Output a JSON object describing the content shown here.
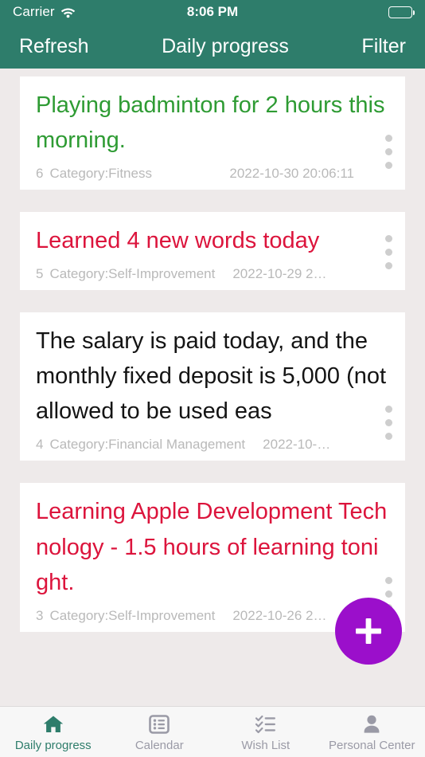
{
  "status_bar": {
    "carrier": "Carrier",
    "wifi_icon": "wifi-icon",
    "time": "8:06 PM",
    "battery_icon": "battery-full-icon"
  },
  "nav_bar": {
    "left_button": "Refresh",
    "title": "Daily progress",
    "right_button": "Filter"
  },
  "colors": {
    "brand_teal": "#2E7D6B",
    "page_background": "#EEEAEA",
    "card_background": "#FFFFFF",
    "accent_green": "#2E9B33",
    "accent_red": "#DC143C",
    "text_black": "#141414",
    "meta_gray": "#B9B9B9",
    "fab_purple": "#9B0FCB",
    "tab_inactive": "#9A9AA6"
  },
  "list": {
    "items": [
      {
        "title": "Playing badminton for 2 hours this morning.",
        "color": "green",
        "id": "6",
        "category": "Category:Fitness",
        "date": "2022-10-30 20:06:11",
        "menu_icon": "more-vertical-icon"
      },
      {
        "title": "Learned 4 new words today",
        "color": "red",
        "id": "5",
        "category": "Category:Self-Improvement",
        "date": "2022-10-29 2…",
        "menu_icon": "more-vertical-icon"
      },
      {
        "title": "The salary is paid today, and the monthly fixed deposit is 5,000 (not allowed to be used eas",
        "color": "black",
        "id": "4",
        "category": "Category:Financial Management",
        "date": "2022-10-…",
        "menu_icon": "more-vertical-icon"
      },
      {
        "title": "Learning Apple Development Technology - 1.5 hours of learning tonight.",
        "color": "red",
        "id": "3",
        "category": "Category:Self-Improvement",
        "date": "2022-10-26 2…",
        "menu_icon": "more-vertical-icon"
      }
    ]
  },
  "fab": {
    "icon": "plus-icon",
    "label": "Add"
  },
  "tab_bar": {
    "items": [
      {
        "label": "Daily progress",
        "icon": "home-icon",
        "active": true
      },
      {
        "label": "Calendar",
        "icon": "list-icon",
        "active": false
      },
      {
        "label": "Wish List",
        "icon": "checklist-icon",
        "active": false
      },
      {
        "label": "Personal Center",
        "icon": "person-icon",
        "active": false
      }
    ]
  }
}
